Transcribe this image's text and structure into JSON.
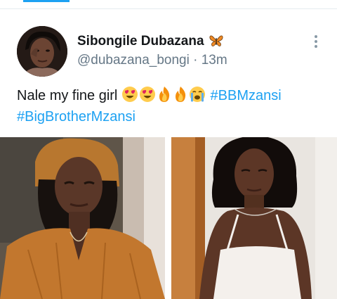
{
  "tweet": {
    "author_name": "Sibongile Dubazana",
    "handle": "@dubazana_bongi",
    "separator": "·",
    "time": "13m",
    "text_prefix": "Nale my fine girl",
    "emojis": [
      "heart-eyes-emoji",
      "heart-eyes-emoji",
      "fire-emoji",
      "fire-emoji",
      "crying-emoji"
    ],
    "hashtags": [
      "#BBMzansi",
      "#BigBrotherMzansi"
    ]
  },
  "colors": {
    "link": "#1da1f2",
    "text": "#14171a",
    "secondary": "#657786"
  }
}
